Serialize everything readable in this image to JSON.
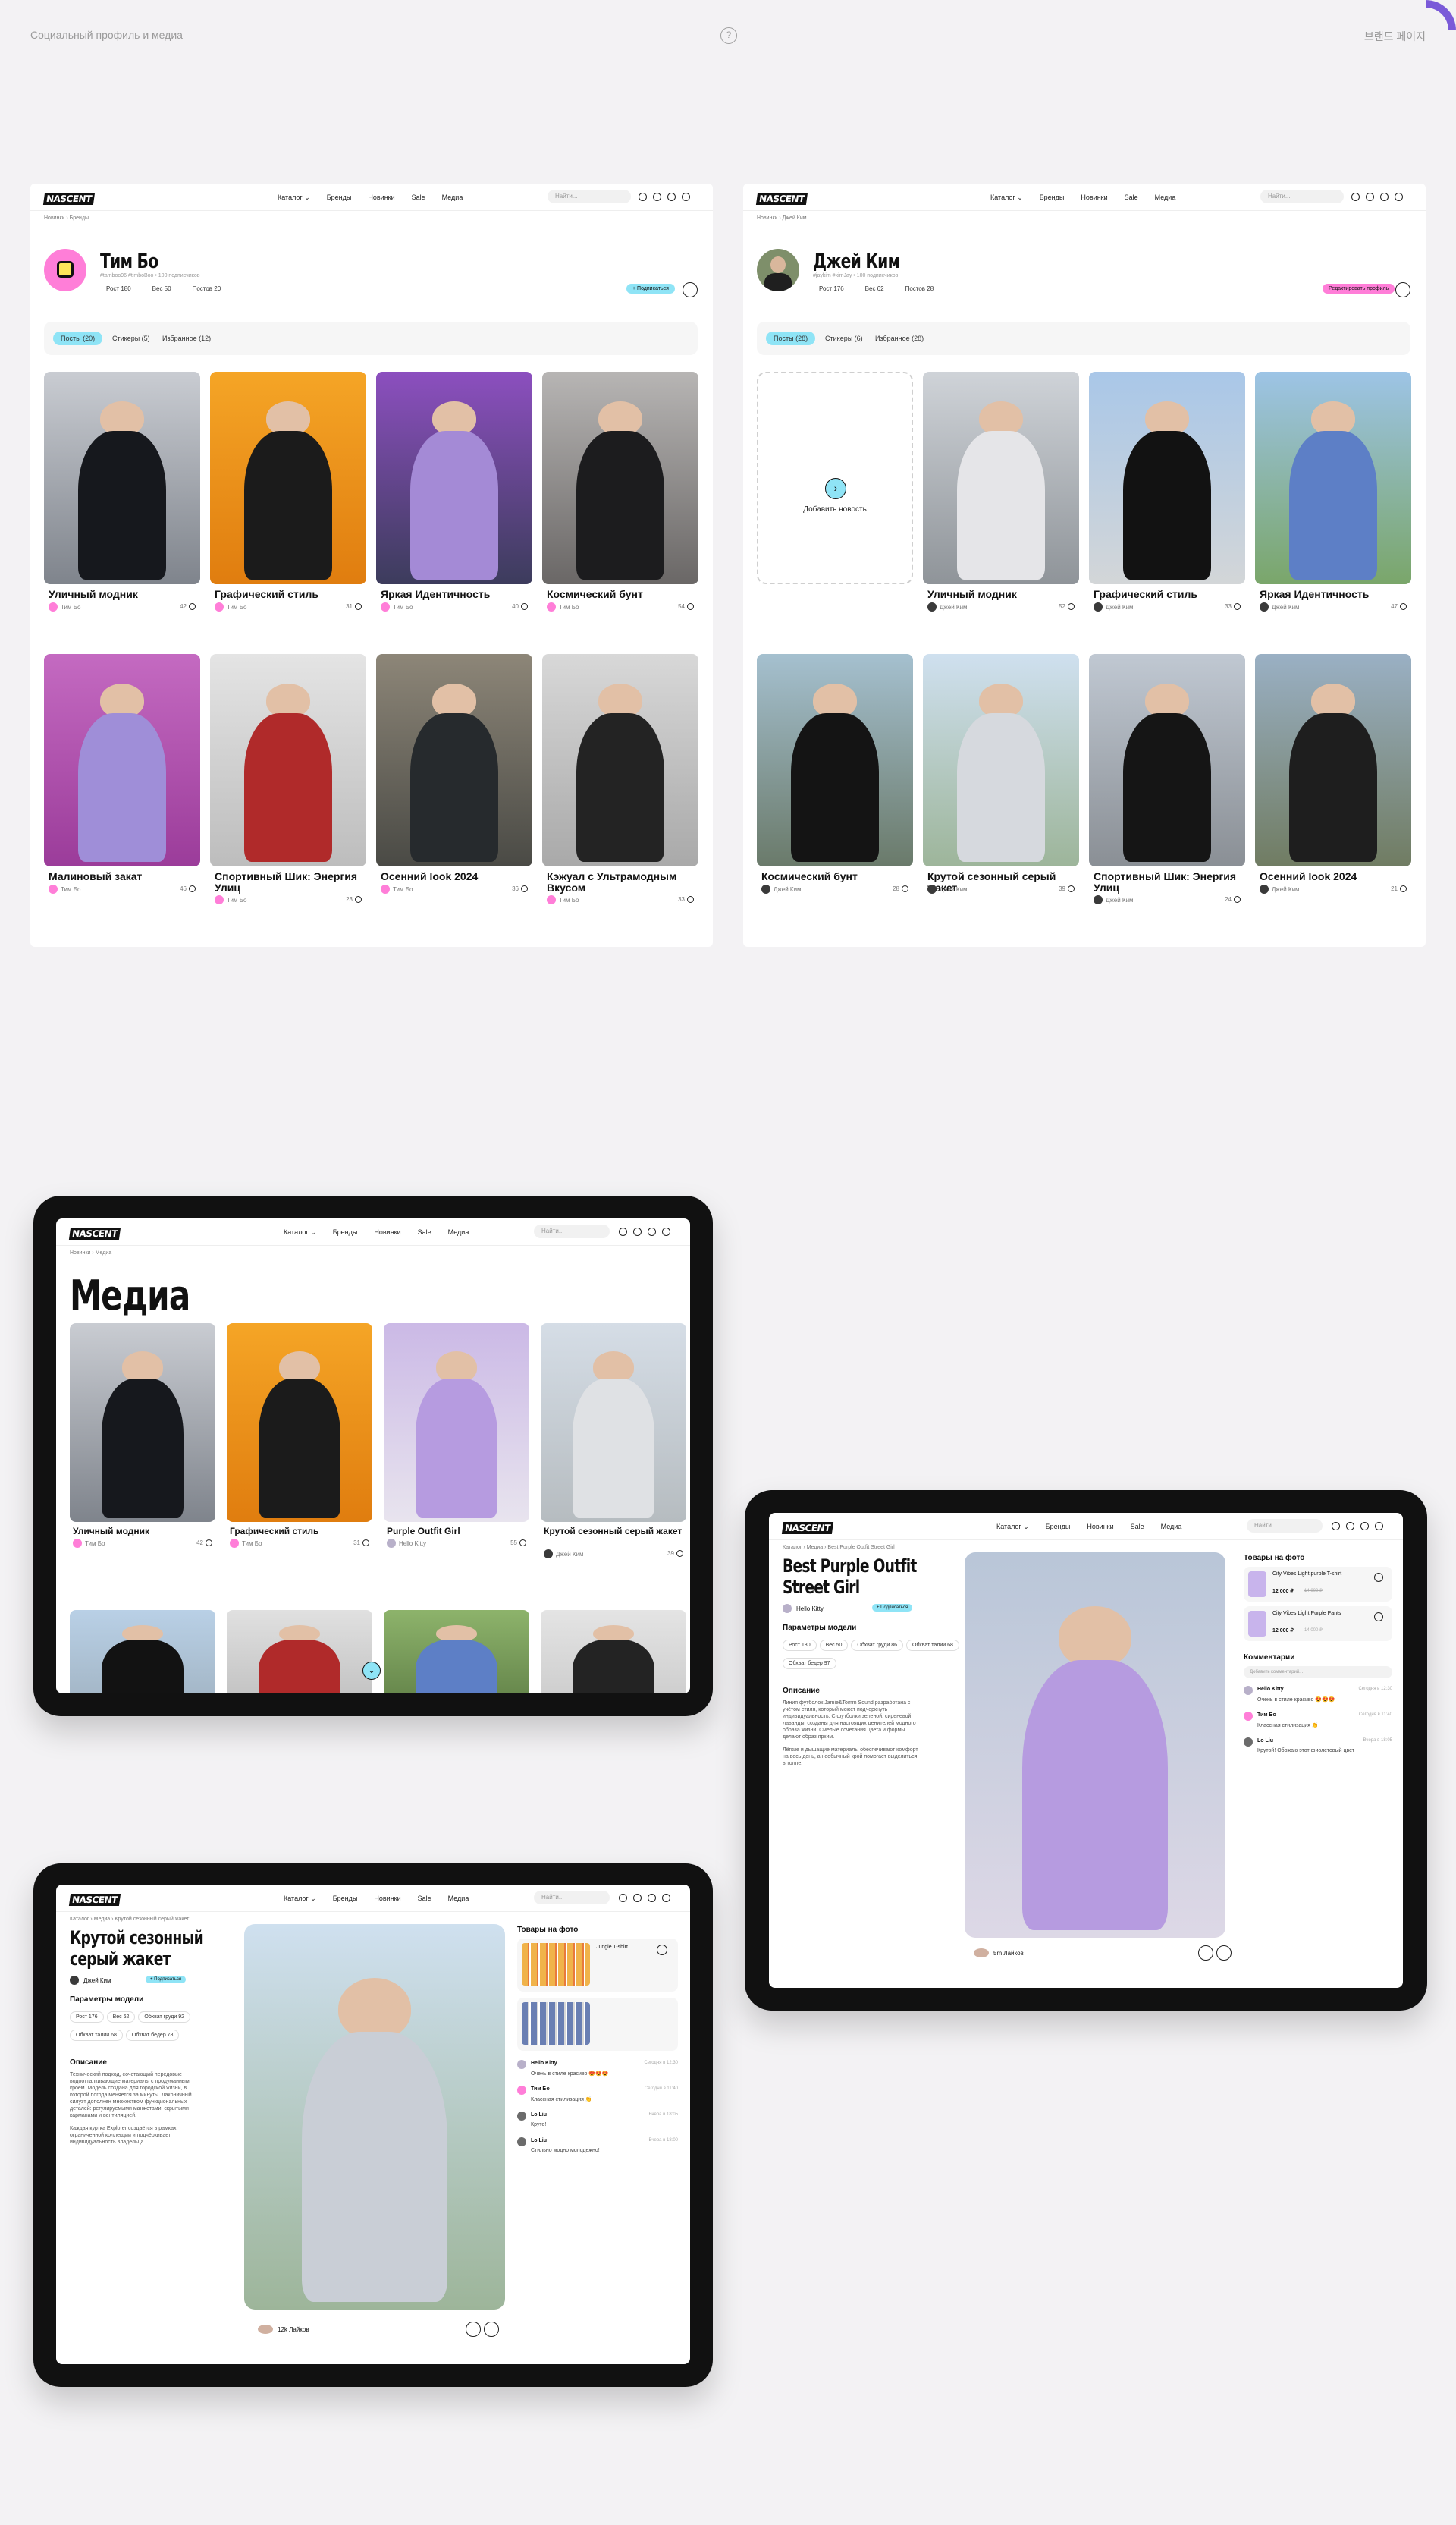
{
  "top": {
    "left": "Социальный профиль и медиа",
    "center": "?",
    "right": "브랜드 페이지"
  },
  "nav": {
    "logo": "NASCENT",
    "menu": [
      "Каталог ⌄",
      "Бренды",
      "Новинки",
      "Sale",
      "Медиа"
    ],
    "search": "Найти..."
  },
  "profile1": {
    "crumb": "Новинки  ›  Бренды",
    "name": "Тим Бо",
    "handle": "#tamboo96 #timboBoo  •  100 подписчиков",
    "stats": [
      "Рост 180",
      "Вес 50",
      "Постов 20"
    ],
    "action": "+ Подписаться",
    "tabs": [
      "Посты (20)",
      "Стикеры (5)",
      "Избранное (12)"
    ],
    "author": "Тим Бо",
    "cards": [
      {
        "title": "Уличный модник",
        "likes": "42"
      },
      {
        "title": "Графический стиль",
        "likes": "31"
      },
      {
        "title": "Яркая Идентичность",
        "likes": "40"
      },
      {
        "title": "Космический бунт",
        "likes": "54"
      },
      {
        "title": "Малиновый закат",
        "likes": "46"
      },
      {
        "title": "Спортивный Шик: Энергия Улиц",
        "likes": "23"
      },
      {
        "title": "Осенний look 2024",
        "likes": "36"
      },
      {
        "title": "Кэжуал с Ультрамодным Вкусом",
        "likes": "33"
      }
    ]
  },
  "profile2": {
    "crumb": "Новинки  ›  Джей Ким",
    "name": "Джей Ким",
    "handle": "#jaykim #kimJay  •  100 подписчиков",
    "stats": [
      "Рост 176",
      "Вес 62",
      "Постов 28"
    ],
    "action": "Редактировать профиль",
    "tabs": [
      "Посты (28)",
      "Стикеры (6)",
      "Избранное (28)"
    ],
    "add": "Добавить новость",
    "author": "Джей Ким",
    "cards": [
      {
        "title": "Уличный модник",
        "likes": "52"
      },
      {
        "title": "Графический стиль",
        "likes": "33"
      },
      {
        "title": "Яркая Идентичность",
        "likes": "47"
      },
      {
        "title": "Космический бунт",
        "likes": "28"
      },
      {
        "title": "Крутой сезонный серый жакет",
        "likes": "39"
      },
      {
        "title": "Спортивный Шик: Энергия Улиц",
        "likes": "24"
      },
      {
        "title": "Осенний look 2024",
        "likes": "21"
      }
    ]
  },
  "media": {
    "crumb": "Новинки  ›  Медиа",
    "title": "Медиа",
    "cards": [
      {
        "title": "Уличный модник",
        "author": "Тим Бо",
        "likes": "42"
      },
      {
        "title": "Графический стиль",
        "author": "Тим Бо",
        "likes": "31"
      },
      {
        "title": "Purple Outfit Girl",
        "author": "Hello Kitty",
        "likes": "55"
      },
      {
        "title": "Крутой сезонный серый жакет",
        "author": "Джей Ким",
        "likes": "39"
      }
    ]
  },
  "post1": {
    "crumb": "Каталог  ›  Медиа  ›  Крутой сезонный серый жакет",
    "title": "Крутой сезонный серый жакет",
    "author": "Джей Ким",
    "follow": "+ Подписаться",
    "params_label": "Параметры модели",
    "params": [
      "Рост 176",
      "Вес 62",
      "Обхват груди 92",
      "Обхват талии 68",
      "Обхват бедер 78"
    ],
    "desc_label": "Описание",
    "desc": "Технический подход, сочетающий передовые водоотталкивающие материалы с продуманным кроем. Модель создана для городской жизни, в которой погода меняется за минуты. Лаконичный силуэт дополнен множеством функциональных деталей: регулируемыми манжетами, скрытыми карманами и вентиляцией.",
    "desc2": "Каждая куртка Explorer создаётся в рамках ограниченной коллекции и подчёркивает индивидуальность владельца.",
    "likes": "12k Лайков",
    "items_label": "Товары на фото",
    "item_name": "Jungle T-shirt",
    "comments": [
      {
        "name": "Hello Kitty",
        "text": "Очень в стиле красиво 😍😍😍",
        "date": "Сегодня в 12:30"
      },
      {
        "name": "Тим Бо",
        "text": "Классная стилизация 👏",
        "date": "Сегодня в 11:40"
      },
      {
        "name": "Lo Liu",
        "text": "Круто!",
        "date": "Вчера в 18:05"
      },
      {
        "name": "Lo Liu",
        "text": "Стильно модно молодежно!",
        "date": "Вчера в 18:00"
      }
    ]
  },
  "post2": {
    "crumb": "Каталог  ›  Медиа  ›  Best Purple Outfit Street Girl",
    "title": "Best Purple Outfit Street Girl",
    "author": "Hello Kitty",
    "follow": "+ Подписаться",
    "params_label": "Параметры модели",
    "params": [
      "Рост 180",
      "Вес 50",
      "Обхват груди 86",
      "Обхват талии 68",
      "Обхват бедер 97"
    ],
    "desc_label": "Описание",
    "desc": "Линия футболок Jamie&Tomm Sound разработана с учётом стиля, который может подчеркнуть индивидуальность. С футболки зеленой, сиреневой лаванды, созданы для настоящих ценителей модного образа жизни. Смелые сочетания цвета и формы делают образ ярким.",
    "desc2": "Лёгкие и дышащие материалы обеспечивают комфорт на весь день, а необычный крой помогает выделиться в толпе.",
    "likes": "5m Лайков",
    "items_label": "Товары на фото",
    "items": [
      {
        "name": "City Vibes Light purple T-shirt",
        "price": "12 000 ₽",
        "old": "14 000 ₽"
      },
      {
        "name": "City Vibes Light Purple Pants",
        "price": "12 000 ₽",
        "old": "14 000 ₽"
      }
    ],
    "comments_label": "Комментарии",
    "comment_ph": "Добавить комментарий...",
    "comments": [
      {
        "name": "Hello Kitty",
        "text": "Очень в стиле красиво 😍😍😍",
        "date": "Сегодня в 12:30"
      },
      {
        "name": "Тим Бо",
        "text": "Классная стилизация 👏",
        "date": "Сегодня в 11:40"
      },
      {
        "name": "Lo Liu",
        "text": "Крутой! Обожаю этот фиолетовый цвет",
        "date": "Вчера в 18:05"
      }
    ]
  }
}
